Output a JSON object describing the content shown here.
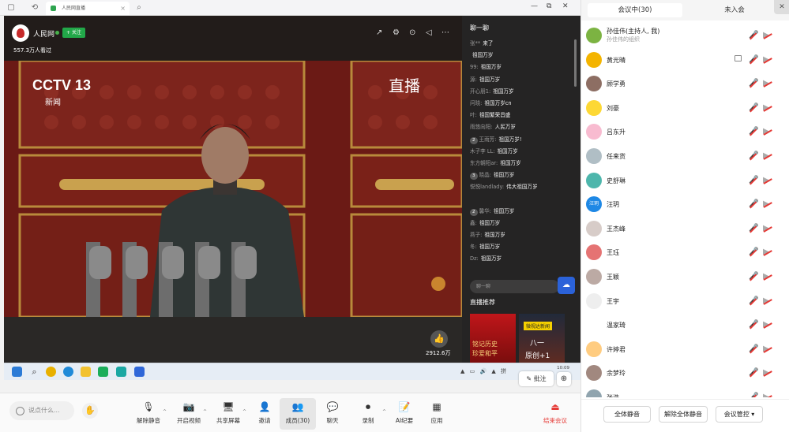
{
  "browser": {
    "tab_title": "人民网直播",
    "controls": [
      "—",
      "⧉",
      "✕"
    ]
  },
  "player": {
    "channel_name": "人民网",
    "follow_label": "+ 关注",
    "viewers": "557.3万人看过",
    "video_logo": "CCTV 13",
    "video_logo_sub": "新闻",
    "live_badge": "直播",
    "like_count": "2912.6万"
  },
  "chat": {
    "title": "聊一聊",
    "messages": [
      {
        "badge": "",
        "user": "张**",
        "text": "来了"
      },
      {
        "badge": "",
        "user": "",
        "text": "祖国万岁"
      },
      {
        "badge": "",
        "user": "99:",
        "text": "祖国万岁"
      },
      {
        "badge": "",
        "user": "源:",
        "text": "祖国万岁"
      },
      {
        "badge": "",
        "user": "开心朋1:",
        "text": "祖国万岁"
      },
      {
        "badge": "",
        "user": "问晓:",
        "text": "祖国万岁cn"
      },
      {
        "badge": "",
        "user": "叶:",
        "text": "祖国繁荣昌盛"
      },
      {
        "badge": "",
        "user": "雨悠向阳:",
        "text": "人民万岁"
      },
      {
        "badge": "2",
        "user": "王雨芳:",
        "text": "祖国万岁!"
      },
      {
        "badge": "",
        "user": "木子李 LL:",
        "text": "祖国万岁"
      },
      {
        "badge": "",
        "user": "东方朝阳ar:",
        "text": "祖国万岁"
      },
      {
        "badge": "3",
        "user": "晓晶:",
        "text": "祖国万岁"
      },
      {
        "badge": "",
        "user": "悦悦landlady:",
        "text": "伟大祖国万岁"
      },
      {
        "badge": "",
        "user": "",
        "text": ""
      },
      {
        "badge": "2",
        "user": "馨华:",
        "text": "祖国万岁"
      },
      {
        "badge": "",
        "user": "鑫:",
        "text": "祖国万岁"
      },
      {
        "badge": "",
        "user": "燕子:",
        "text": "祖国万岁"
      },
      {
        "badge": "",
        "user": "冬:",
        "text": "祖国万岁"
      },
      {
        "badge": "",
        "user": "Dz:",
        "text": "祖国万岁"
      }
    ],
    "input_placeholder": "聊一聊",
    "recommend_title": "直播推荐",
    "rec1_caption": "铭记历史",
    "rec1_caption2": "珍爱和平",
    "rec2_tag": "微视达新闻",
    "rec2_text": "八一",
    "rec2_text2": "原创+1"
  },
  "taskbar": {
    "tray": "▲ ▭ 🔊 ▲ 拼",
    "time": "10:09",
    "annotate_label": "批注"
  },
  "toolbar": {
    "say_placeholder": "说点什么...",
    "items": [
      {
        "key": "unmute",
        "label": "解除静音",
        "icon": "🎙"
      },
      {
        "key": "video",
        "label": "开启视频",
        "icon": "📷"
      },
      {
        "key": "share",
        "label": "共享屏幕",
        "icon": "🖥"
      },
      {
        "key": "invite",
        "label": "邀请",
        "icon": "👤"
      },
      {
        "key": "members",
        "label": "成员(30)",
        "icon": "👥"
      },
      {
        "key": "chat",
        "label": "聊天",
        "icon": "💬"
      },
      {
        "key": "record",
        "label": "录制",
        "icon": "⏺"
      },
      {
        "key": "ai",
        "label": "AI纪要",
        "icon": "📝"
      },
      {
        "key": "apps",
        "label": "应用",
        "icon": "▦"
      },
      {
        "key": "end",
        "label": "结束会议",
        "icon": "⏏"
      }
    ]
  },
  "panel": {
    "tab_in": "会议中(30)",
    "tab_out": "未入会",
    "close": "✕",
    "participants": [
      {
        "name": "孙佳伟(主持人, 我)",
        "sub": "孙佳伟的组织",
        "avatar_color": "#7cb342"
      },
      {
        "name": "黄光晴",
        "sub": "",
        "avatar_color": "#f4b400"
      },
      {
        "name": "顾学勇",
        "sub": "",
        "avatar_color": "#8d6e63"
      },
      {
        "name": "刘豪",
        "sub": "",
        "avatar_color": "#fdd835"
      },
      {
        "name": "吕东升",
        "sub": "",
        "avatar_color": "#f8bbd0"
      },
      {
        "name": "任来货",
        "sub": "",
        "avatar_color": "#b0bec5"
      },
      {
        "name": "史舒琳",
        "sub": "",
        "avatar_color": "#4db6ac"
      },
      {
        "name": "汪玥",
        "sub": "",
        "avatar_color": "#1e88e5",
        "avatar_text": "汪玥"
      },
      {
        "name": "王杰峰",
        "sub": "",
        "avatar_color": "#d7ccc8"
      },
      {
        "name": "王珏",
        "sub": "",
        "avatar_color": "#e57373"
      },
      {
        "name": "王颖",
        "sub": "",
        "avatar_color": "#bcaaa4"
      },
      {
        "name": "王宇",
        "sub": "",
        "avatar_color": "#eeeeee"
      },
      {
        "name": "温家琦",
        "sub": "",
        "avatar_color": "#ffffff"
      },
      {
        "name": "许婷君",
        "sub": "",
        "avatar_color": "#ffcc80"
      },
      {
        "name": "余梦玲",
        "sub": "",
        "avatar_color": "#a1887f"
      },
      {
        "name": "张浩",
        "sub": "",
        "avatar_color": "#90a4ae"
      }
    ],
    "mute_all": "全体静音",
    "unmute_all": "解除全体静音",
    "meeting_control": "会议管控 ▾"
  }
}
